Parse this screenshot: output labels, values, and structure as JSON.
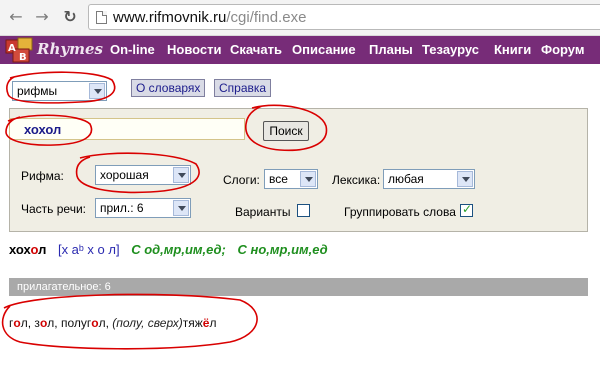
{
  "browser": {
    "url_host": "www.rifmovnik.ru",
    "url_path": "/cgi/find.exe",
    "back_icon": "arrow-left",
    "forward_icon": "arrow-right",
    "reload_icon": "reload"
  },
  "site": {
    "logo_text": "Rhymes",
    "nav": [
      "On-line",
      "Новости",
      "Скачать",
      "Описание",
      "Планы",
      "Тезаурус",
      "Книги",
      "Форум"
    ],
    "brand_color": "#772c78"
  },
  "controls": {
    "mode_select": "рифмы",
    "about_button": "О словарях",
    "help_button": "Справка"
  },
  "search": {
    "query": "хохол",
    "submit_label": "Поиск",
    "rhyme_label": "Рифма:",
    "rhyme_value": "хорошая",
    "syllables_label": "Слоги:",
    "syllables_value": "все",
    "lexicon_label": "Лексика:",
    "lexicon_value": "любая",
    "pos_label": "Часть речи:",
    "pos_value": "прил.: 6",
    "variants_label": "Варианты",
    "variants_checked": false,
    "group_label": "Группировать слова",
    "group_checked": true
  },
  "result": {
    "word_pre": "хох",
    "word_stressed": "о",
    "word_post": "л",
    "transcription": "[х аᵇ х о л]",
    "morph1": "С од,мр,им,ед;",
    "morph2": "С но,мр,им,ед",
    "section_title": "прилагательное: 6",
    "rhymes": [
      {
        "pre": "г",
        "stress": "о",
        "post": "л",
        "sep": ", "
      },
      {
        "pre": "з",
        "stress": "о",
        "post": "л",
        "sep": ", "
      },
      {
        "pre": "полуг",
        "stress": "о",
        "post": "л",
        "sep": ", "
      }
    ],
    "rhyme_note": "(полу, сверх)",
    "last_rhyme_pre": "тяж",
    "last_rhyme_stress": "ё",
    "last_rhyme_post": "л"
  }
}
